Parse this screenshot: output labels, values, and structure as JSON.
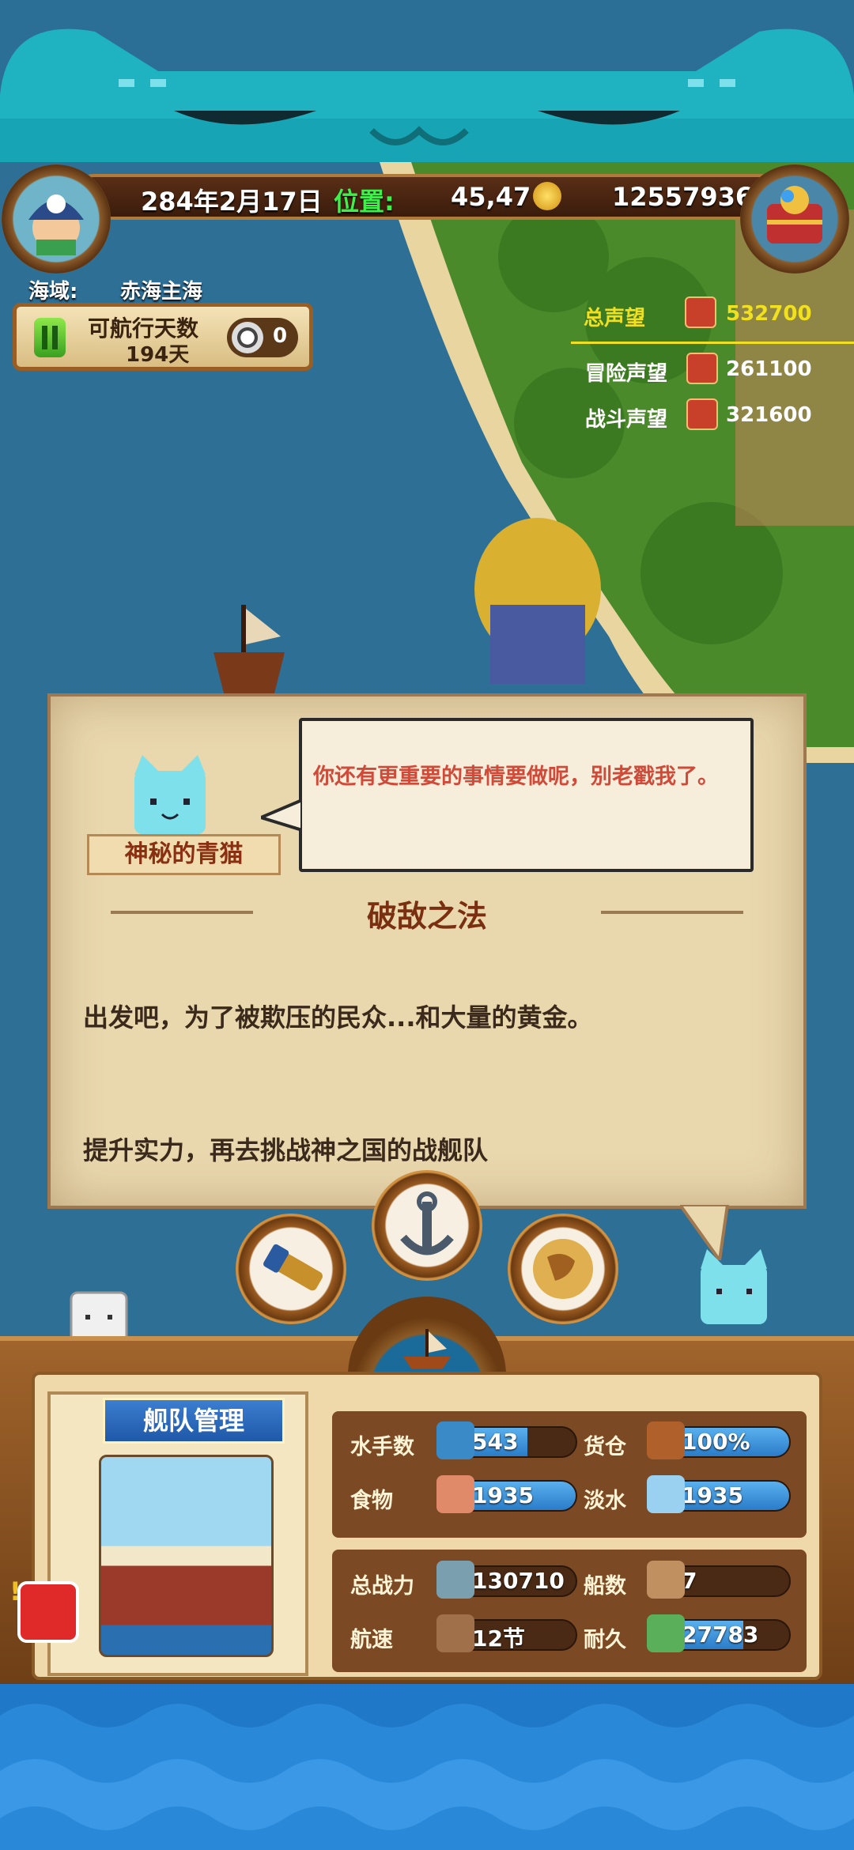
{
  "header": {
    "date": "284年2月17日",
    "position_label": "位置:",
    "position_value": "45,47",
    "gold": "12557936"
  },
  "sea": {
    "label": "海域:",
    "name": "赤海主海"
  },
  "voyage": {
    "label": "可航行天数",
    "days": "194天",
    "counter": "0"
  },
  "reputation": {
    "total_label": "总声望",
    "total_value": "532700",
    "adventure_label": "冒险声望",
    "adventure_value": "261100",
    "battle_label": "战斗声望",
    "battle_value": "321600"
  },
  "dialog": {
    "npc_name": "神秘的青猫",
    "speech": "你还有更重要的事情要做呢，别老戳我了。",
    "task_title": "破敌之法",
    "line1": "出发吧，为了被欺压的民众...和大量的黄金。",
    "line2": "提升实力，再去挑战神之国的战舰队"
  },
  "fleet": {
    "title": "舰队管理",
    "stats": {
      "sailors_label": "水手数",
      "sailors_value": "543",
      "sailors_fill": 0.62,
      "cargo_label": "货仓",
      "cargo_value": "100%",
      "cargo_fill": 1.0,
      "food_label": "食物",
      "food_value": "1935",
      "food_fill": 1.0,
      "water_label": "淡水",
      "water_value": "1935",
      "water_fill": 1.0,
      "power_label": "总战力",
      "power_value": "130710",
      "power_fill": 0,
      "ships_label": "船数",
      "ships_value": "7",
      "ships_fill": 0,
      "speed_label": "航速",
      "speed_value": "12节",
      "speed_fill": 0,
      "durability_label": "耐久",
      "durability_value": "27783",
      "durability_fill": 0.65
    }
  },
  "colors": {
    "teal": "#1fb3c2",
    "panel_brown": "#7b4a25",
    "bar_blue": "#2a7cc8",
    "rep_gold": "#f0e020"
  },
  "icons": [
    "cat-frame",
    "pirate-avatar",
    "treasure-chest",
    "gold-coin",
    "spyglass",
    "anchor",
    "globe",
    "ship-wheel",
    "fleet-ship",
    "alert-ship"
  ]
}
